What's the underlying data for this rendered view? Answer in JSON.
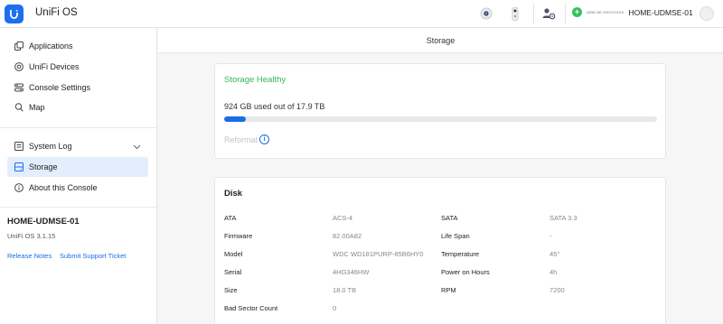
{
  "app": {
    "title": "UniFi OS"
  },
  "topbar": {
    "console_model": "UDM-SE-XXXXXXXX",
    "console_name": "HOME-UDMSE-01",
    "icons": [
      "unifi-logo-icon",
      "protect-camera-icon",
      "doorbell-icon",
      "users-settings-icon",
      "green-plus-icon",
      "user-avatar-icon"
    ]
  },
  "sidebar": {
    "items": [
      {
        "label": "Applications",
        "icon": "applications-icon"
      },
      {
        "label": "UniFi Devices",
        "icon": "devices-icon"
      },
      {
        "label": "Console Settings",
        "icon": "settings-icon"
      },
      {
        "label": "Map",
        "icon": "map-pin-icon"
      },
      {
        "label": "System Log",
        "icon": "log-icon"
      },
      {
        "label": "Storage",
        "icon": "storage-icon",
        "active": true
      },
      {
        "label": "About this Console",
        "icon": "info-icon"
      }
    ],
    "console_name": "HOME-UDMSE-01",
    "console_version": "UniFi OS 3.1.15",
    "links": {
      "release_notes": "Release Notes",
      "support": "Submit Support Ticket"
    }
  },
  "main": {
    "page_title": "Storage",
    "storage": {
      "health": "Storage Healthy",
      "usage": "924 GB used out of 17.9 TB",
      "used_fraction": 0.05,
      "reformat": "Reformat"
    },
    "disk": {
      "title": "Disk",
      "left": [
        {
          "label": "ATA",
          "value": "ACS-4"
        },
        {
          "label": "Firmware",
          "value": "82.00A82"
        },
        {
          "label": "Model",
          "value": "WDC WD181PURP-85B6HY0"
        },
        {
          "label": "Serial",
          "value": "4HG346HW"
        },
        {
          "label": "Size",
          "value": "18.0 TB"
        },
        {
          "label": "Bad Sector Count",
          "value": "0"
        }
      ],
      "right": [
        {
          "label": "SATA",
          "value": "SATA 3.3"
        },
        {
          "label": "Life Span",
          "value": "-"
        },
        {
          "label": "Temperature",
          "value": "45°"
        },
        {
          "label": "Power on Hours",
          "value": "4h"
        },
        {
          "label": "RPM",
          "value": "7200"
        }
      ]
    }
  },
  "colors": {
    "accent": "#1a6ee6",
    "healthy": "#38b35a",
    "active_bg": "#e2eefc"
  }
}
